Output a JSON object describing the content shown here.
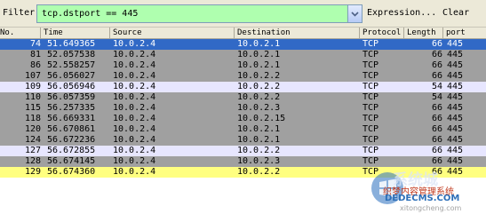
{
  "filter": {
    "label": "Filter:",
    "value": "tcp.dstport == 445",
    "expression_label": "Expression...",
    "clear_label": "Clear"
  },
  "columns": [
    "No.",
    "Time",
    "Source",
    "Destination",
    "Protocol",
    "Length",
    "port"
  ],
  "rows": [
    {
      "no": "74",
      "time": "51.649365",
      "source": "10.0.2.4",
      "destination": "10.0.2.1",
      "protocol": "TCP",
      "length": "66",
      "port": "445",
      "bg": "#3169c6",
      "fg": "#ffffff"
    },
    {
      "no": "81",
      "time": "52.057538",
      "source": "10.0.2.4",
      "destination": "10.0.2.1",
      "protocol": "TCP",
      "length": "66",
      "port": "445",
      "bg": "#a0a0a0",
      "fg": "#000000"
    },
    {
      "no": "86",
      "time": "52.558257",
      "source": "10.0.2.4",
      "destination": "10.0.2.1",
      "protocol": "TCP",
      "length": "66",
      "port": "445",
      "bg": "#a0a0a0",
      "fg": "#000000"
    },
    {
      "no": "107",
      "time": "56.056027",
      "source": "10.0.2.4",
      "destination": "10.0.2.2",
      "protocol": "TCP",
      "length": "66",
      "port": "445",
      "bg": "#a0a0a0",
      "fg": "#000000"
    },
    {
      "no": "109",
      "time": "56.056946",
      "source": "10.0.2.4",
      "destination": "10.0.2.2",
      "protocol": "TCP",
      "length": "54",
      "port": "445",
      "bg": "#e7e6ff",
      "fg": "#000000"
    },
    {
      "no": "110",
      "time": "56.057359",
      "source": "10.0.2.4",
      "destination": "10.0.2.2",
      "protocol": "TCP",
      "length": "54",
      "port": "445",
      "bg": "#a0a0a0",
      "fg": "#000000"
    },
    {
      "no": "115",
      "time": "56.257335",
      "source": "10.0.2.4",
      "destination": "10.0.2.3",
      "protocol": "TCP",
      "length": "66",
      "port": "445",
      "bg": "#a0a0a0",
      "fg": "#000000"
    },
    {
      "no": "118",
      "time": "56.669331",
      "source": "10.0.2.4",
      "destination": "10.0.2.15",
      "protocol": "TCP",
      "length": "66",
      "port": "445",
      "bg": "#a0a0a0",
      "fg": "#000000"
    },
    {
      "no": "120",
      "time": "56.670861",
      "source": "10.0.2.4",
      "destination": "10.0.2.1",
      "protocol": "TCP",
      "length": "66",
      "port": "445",
      "bg": "#a0a0a0",
      "fg": "#000000"
    },
    {
      "no": "124",
      "time": "56.672236",
      "source": "10.0.2.4",
      "destination": "10.0.2.1",
      "protocol": "TCP",
      "length": "66",
      "port": "445",
      "bg": "#a0a0a0",
      "fg": "#000000"
    },
    {
      "no": "127",
      "time": "56.672855",
      "source": "10.0.2.4",
      "destination": "10.0.2.2",
      "protocol": "TCP",
      "length": "66",
      "port": "445",
      "bg": "#e7e6ff",
      "fg": "#000000"
    },
    {
      "no": "128",
      "time": "56.674145",
      "source": "10.0.2.4",
      "destination": "10.0.2.3",
      "protocol": "TCP",
      "length": "66",
      "port": "445",
      "bg": "#a0a0a0",
      "fg": "#000000"
    },
    {
      "no": "129",
      "time": "56.674360",
      "source": "10.0.2.4",
      "destination": "10.0.2.2",
      "protocol": "TCP",
      "length": "66",
      "port": "445",
      "bg": "#ffff80",
      "fg": "#000000"
    }
  ],
  "watermark": {
    "line1": "系统城",
    "line2": "织梦内容管理系统",
    "line3": "DEDECMS.COM",
    "line4": "xitongcheng.com",
    "logo_icon": "windows-flag-icon"
  }
}
